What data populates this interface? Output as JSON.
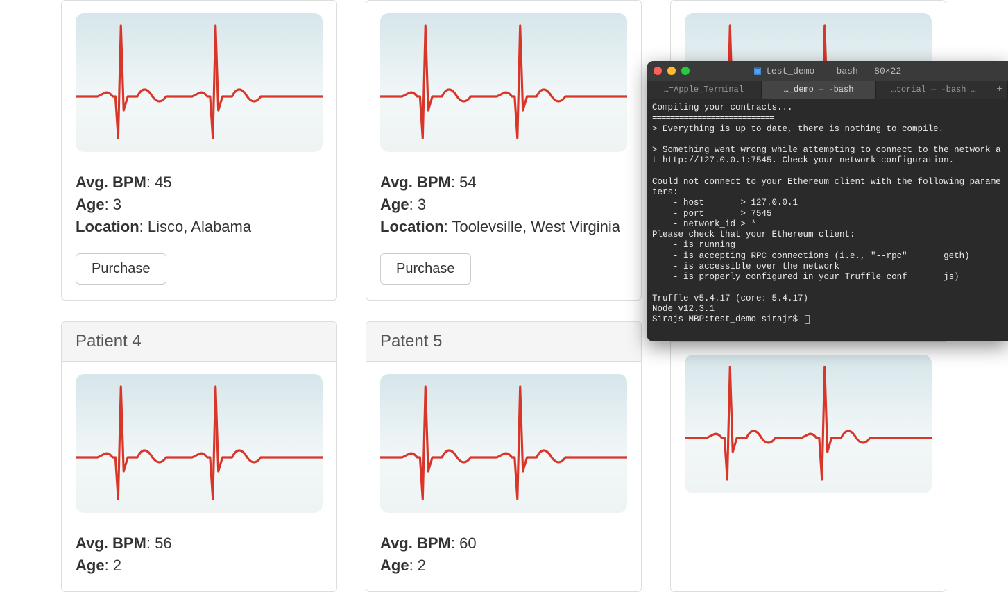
{
  "labels": {
    "bpm": "Avg. BPM",
    "age": "Age",
    "location": "Location",
    "purchase": "Purchase"
  },
  "cards": [
    {
      "title": "",
      "bpm": "45",
      "age": "3",
      "location": "Lisco, Alabama",
      "show_header": false,
      "show_button": true,
      "show_location": true
    },
    {
      "title": "",
      "bpm": "54",
      "age": "3",
      "location": "Toolevsille, West Virginia",
      "show_header": false,
      "show_button": true,
      "show_location": true
    },
    {
      "title": "",
      "bpm": "",
      "age": "",
      "location": "",
      "show_header": false,
      "show_button": false,
      "show_location": false
    },
    {
      "title": "Patient 4",
      "bpm": "56",
      "age": "2",
      "location": "",
      "show_header": true,
      "show_button": false,
      "show_location": false
    },
    {
      "title": "Patent 5",
      "bpm": "60",
      "age": "2",
      "location": "",
      "show_header": true,
      "show_button": false,
      "show_location": false
    },
    {
      "title": "",
      "bpm": "",
      "age": "",
      "location": "",
      "show_header": true,
      "show_button": false,
      "show_location": false
    }
  ],
  "terminal": {
    "title": "test_demo — -bash — 80×22",
    "tabs": [
      {
        "label": "…=Apple_Terminal",
        "active": false
      },
      {
        "label": "…_demo — -bash",
        "active": true
      },
      {
        "label": "…torial — -bash  …",
        "active": false
      }
    ],
    "lines": [
      "Compiling your contracts...",
      "===========================",
      "> Everything is up to date, there is nothing to compile.",
      "",
      "> Something went wrong while attempting to connect to the network at http://127.0.0.1:7545. Check your network configuration.",
      "",
      "Could not connect to your Ethereum client with the following parameters:",
      "    - host       > 127.0.0.1",
      "    - port       > 7545",
      "    - network_id > *",
      "Please check that your Ethereum client:",
      "    - is running",
      "    - is accepting RPC connections (i.e., \"--rpc\"       geth)",
      "    - is accessible over the network",
      "    - is properly configured in your Truffle conf       js)",
      "",
      "Truffle v5.4.17 (core: 5.4.17)",
      "Node v12.3.1"
    ],
    "prompt": "Sirajs-MBP:test_demo sirajr$ "
  }
}
